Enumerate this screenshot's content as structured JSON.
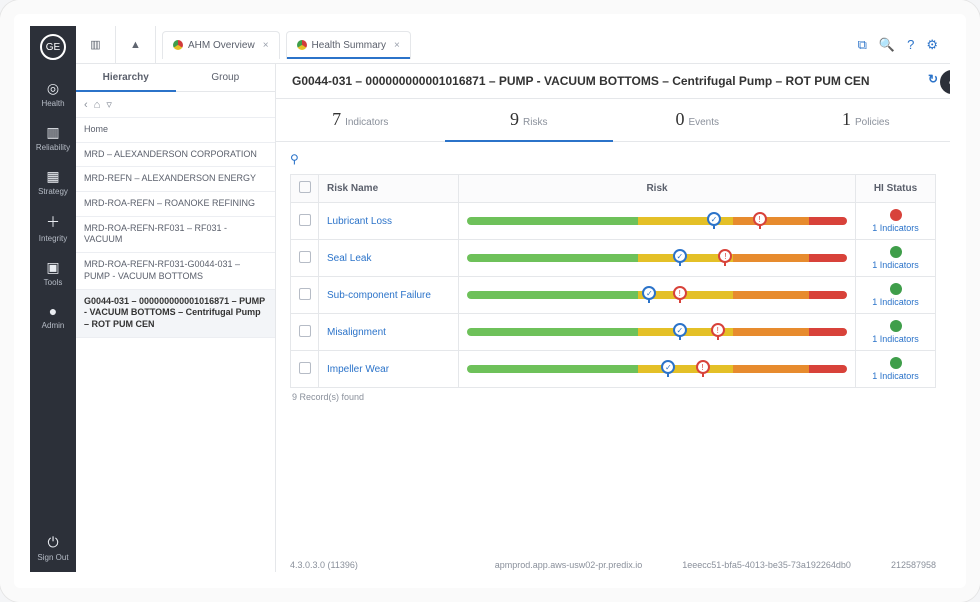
{
  "sidenav": {
    "items": [
      {
        "icon": "◎",
        "label": "Health"
      },
      {
        "icon": "▥",
        "label": "Reliability"
      },
      {
        "icon": "▦",
        "label": "Strategy"
      },
      {
        "icon": "＋",
        "label": "Integrity"
      },
      {
        "icon": "▣",
        "label": "Tools"
      },
      {
        "icon": "●",
        "label": "Admin"
      }
    ],
    "signout": {
      "icon": "⏻",
      "label": "Sign Out"
    }
  },
  "topbar": {
    "tabs": [
      {
        "label": "AHM Overview",
        "active": false
      },
      {
        "label": "Health Summary",
        "active": true
      }
    ]
  },
  "toptools": {
    "dashboard": "⧉",
    "search": "🔍",
    "help": "?",
    "settings": "⚙"
  },
  "leftpanel": {
    "tabs": {
      "hierarchy": "Hierarchy",
      "group": "Group"
    },
    "home": "Home",
    "tree": [
      "MRD – ALEXANDERSON CORPORATION",
      "MRD-REFN – ALEXANDERSON ENERGY",
      "MRD-ROA-REFN – ROANOKE REFINING",
      "MRD-ROA-REFN-RF031 – RF031 - VACUUM",
      "MRD-ROA-REFN-RF031-G0044-031 – PUMP - VACUUM BOTTOMS",
      "G0044-031 – 000000000001016871 – PUMP - VACUUM BOTTOMS – Centrifugal Pump – ROT PUM CEN"
    ]
  },
  "page": {
    "title": "G0044-031 – 000000000001016871 – PUMP - VACUUM BOTTOMS – Centrifugal Pump – ROT PUM CEN",
    "metrics": [
      {
        "num": "7",
        "label": "Indicators"
      },
      {
        "num": "9",
        "label": "Risks"
      },
      {
        "num": "0",
        "label": "Events"
      },
      {
        "num": "1",
        "label": "Policies"
      }
    ],
    "columns": {
      "name": "Risk Name",
      "risk": "Risk",
      "hi": "HI Status"
    },
    "rows": [
      {
        "name": "Lubricant Loss",
        "blue": 65,
        "red": 77,
        "status": "red",
        "status_text": "1 Indicators"
      },
      {
        "name": "Seal Leak",
        "blue": 56,
        "red": 68,
        "status": "green",
        "status_text": "1 Indicators"
      },
      {
        "name": "Sub-component Failure",
        "blue": 48,
        "red": 56,
        "status": "green",
        "status_text": "1 Indicators"
      },
      {
        "name": "Misalignment",
        "blue": 56,
        "red": 66,
        "status": "green",
        "status_text": "1 Indicators"
      },
      {
        "name": "Impeller Wear",
        "blue": 53,
        "red": 62,
        "status": "green",
        "status_text": "1 Indicators"
      }
    ],
    "records_found": "9 Record(s) found"
  },
  "footer": {
    "a": "4.3.0.3.0 (11396)",
    "b": "apmprod.app.aws-usw02-pr.predix.io",
    "c": "1eeecc51-bfa5-4013-be35-73a192264db0",
    "d": "212587958"
  }
}
